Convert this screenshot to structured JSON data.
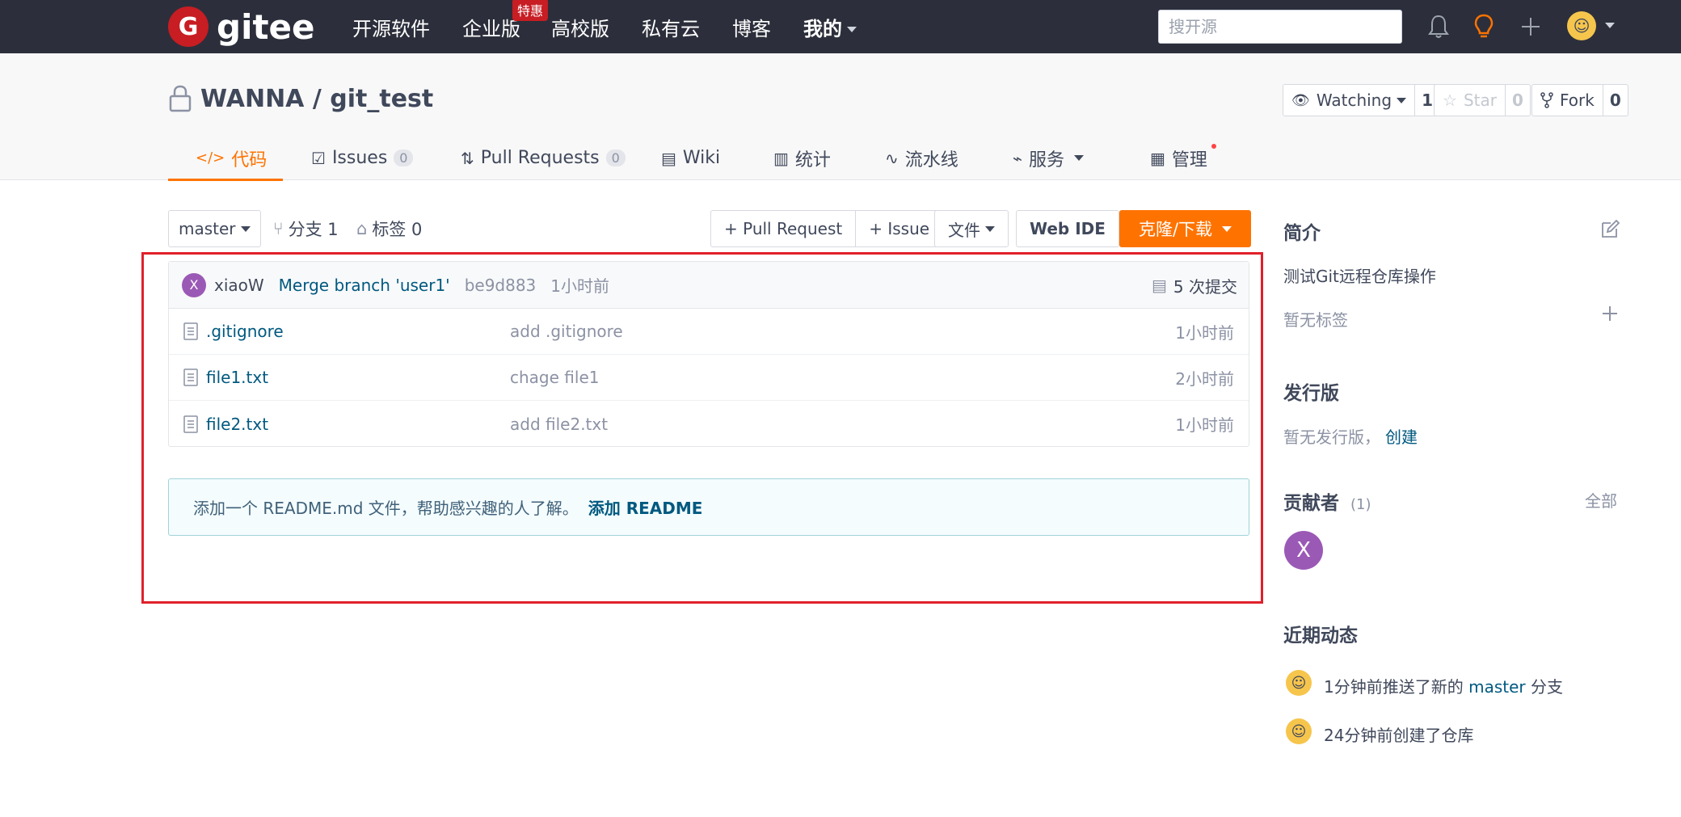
{
  "topbar": {
    "logo_text": "gitee",
    "logo_letter": "G",
    "nav": [
      {
        "label": "开源软件"
      },
      {
        "label": "企业版",
        "badge": "特惠"
      },
      {
        "label": "高校版"
      },
      {
        "label": "私有云"
      },
      {
        "label": "博客"
      },
      {
        "label": "我的"
      }
    ],
    "search_placeholder": "搜开源"
  },
  "repo": {
    "owner": "WANNA",
    "separator": " / ",
    "name": "git_test",
    "watch": {
      "label": "Watching",
      "count": "1"
    },
    "star": {
      "label": "Star",
      "count": "0"
    },
    "fork": {
      "label": "Fork",
      "count": "0"
    }
  },
  "tabs": [
    {
      "label": "代码",
      "icon": "</>"
    },
    {
      "label": "Issues",
      "badge": "0"
    },
    {
      "label": "Pull Requests",
      "badge": "0"
    },
    {
      "label": "Wiki"
    },
    {
      "label": "统计"
    },
    {
      "label": "流水线"
    },
    {
      "label": "服务"
    },
    {
      "label": "管理"
    }
  ],
  "toolbar": {
    "branch": "master",
    "branches": "分支 1",
    "tags": "标签 0",
    "pull_request": "+ Pull Request",
    "issue": "+ Issue",
    "file": "文件",
    "webide": "Web IDE",
    "clone": "克隆/下载"
  },
  "commit": {
    "avatar_letter": "X",
    "author": "xiaoW",
    "message": "Merge branch 'user1'",
    "hash": "be9d883",
    "time": "1小时前",
    "count": "5 次提交"
  },
  "files": [
    {
      "name": ".gitignore",
      "message": "add .gitignore",
      "time": "1小时前"
    },
    {
      "name": "file1.txt",
      "message": "chage file1",
      "time": "2小时前"
    },
    {
      "name": "file2.txt",
      "message": "add file2.txt",
      "time": "1小时前"
    }
  ],
  "readme": {
    "text": "添加一个 README.md 文件，帮助感兴趣的人了解。",
    "link": "添加 README"
  },
  "sidebar": {
    "intro_title": "简介",
    "intro_text": "测试Git远程仓库操作",
    "no_tags": "暂无标签",
    "release_title": "发行版",
    "release_text": "暂无发行版，",
    "release_create": "创建",
    "contrib_title": "贡献者",
    "contrib_count": "(1)",
    "contrib_all": "全部",
    "contrib_avatar": "X",
    "activity_title": "近期动态",
    "activity": [
      {
        "before": "1分钟前推送了新的 ",
        "link": "master",
        "after": " 分支"
      },
      {
        "before": "24分钟前创建了仓库",
        "link": "",
        "after": ""
      }
    ]
  },
  "colors": {
    "accent": "#fe7300",
    "link": "#005980",
    "topbar": "#2c2f3b",
    "highlight": "#e0202a"
  }
}
